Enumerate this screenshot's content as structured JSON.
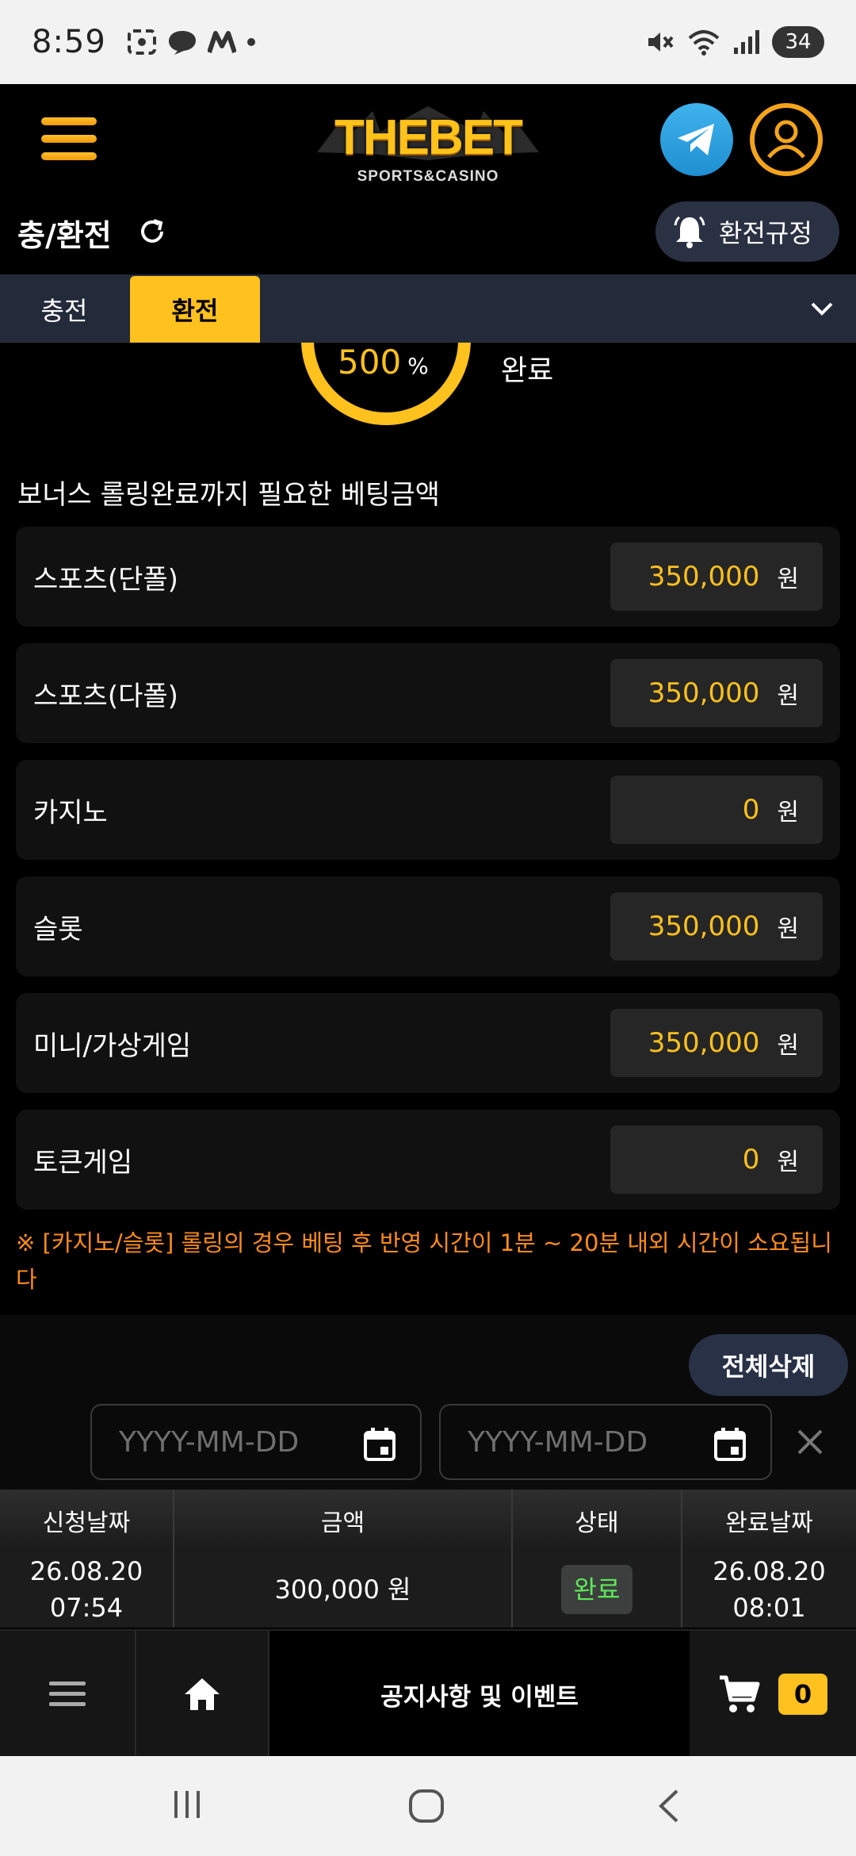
{
  "status_bar": {
    "time": "8:59",
    "battery": "34",
    "left_icons": [
      "screenshot-icon",
      "chat-bubble-icon",
      "app-m-icon",
      "dot-icon"
    ],
    "right_icons": [
      "mute-icon",
      "wifi-icon",
      "signal-icon"
    ]
  },
  "header": {
    "logo_text": "THEBET",
    "logo_sub": "SPORTS&CASINO",
    "menu_icon": "hamburger-icon",
    "telegram_icon": "telegram-icon",
    "user_icon": "user-icon"
  },
  "title_row": {
    "title": "충/환전",
    "refresh_icon": "refresh-icon",
    "rules_label": "환전규정",
    "rules_icon": "bell-icon"
  },
  "tabs": [
    {
      "label": "충전",
      "active": false
    },
    {
      "label": "환전",
      "active": true
    }
  ],
  "rolling": {
    "percent": "500",
    "percent_sign": "%",
    "status": "완료"
  },
  "section_title": "보너스 롤링완료까지 필요한 베팅금액",
  "bet_rows": [
    {
      "label": "스포츠(단폴)",
      "amount": "350,000",
      "unit": "원"
    },
    {
      "label": "스포츠(다폴)",
      "amount": "350,000",
      "unit": "원"
    },
    {
      "label": "카지노",
      "amount": "0",
      "unit": "원"
    },
    {
      "label": "슬롯",
      "amount": "350,000",
      "unit": "원"
    },
    {
      "label": "미니/가상게임",
      "amount": "350,000",
      "unit": "원"
    },
    {
      "label": "토큰게임",
      "amount": "0",
      "unit": "원"
    }
  ],
  "notice": "※ [카지노/슬롯] 롤링의 경우 베팅 후 반영 시간이 1분 ~ 20분 내외 시간이 소요됩니다",
  "history": {
    "delete_all_label": "전체삭제",
    "date_from_placeholder": "YYYY-MM-DD",
    "date_to_placeholder": "YYYY-MM-DD",
    "columns": [
      "신청날짜",
      "금액",
      "상태",
      "완료날짜"
    ],
    "rows": [
      {
        "request_date": "26.08.20",
        "request_time": "07:54",
        "amount": "300,000 원",
        "status": "완료",
        "complete_date": "26.08.20",
        "complete_time": "08:01"
      }
    ]
  },
  "bottom_nav": {
    "notice_label": "공지사항 및 이벤트",
    "cart_count": "0",
    "icons": [
      "menu-icon",
      "home-icon",
      "cart-icon"
    ]
  },
  "colors": {
    "accent": "#ffc11e",
    "notice": "#ff8c1a",
    "complete_green": "#5ee85a",
    "pill_bg": "#283146"
  }
}
